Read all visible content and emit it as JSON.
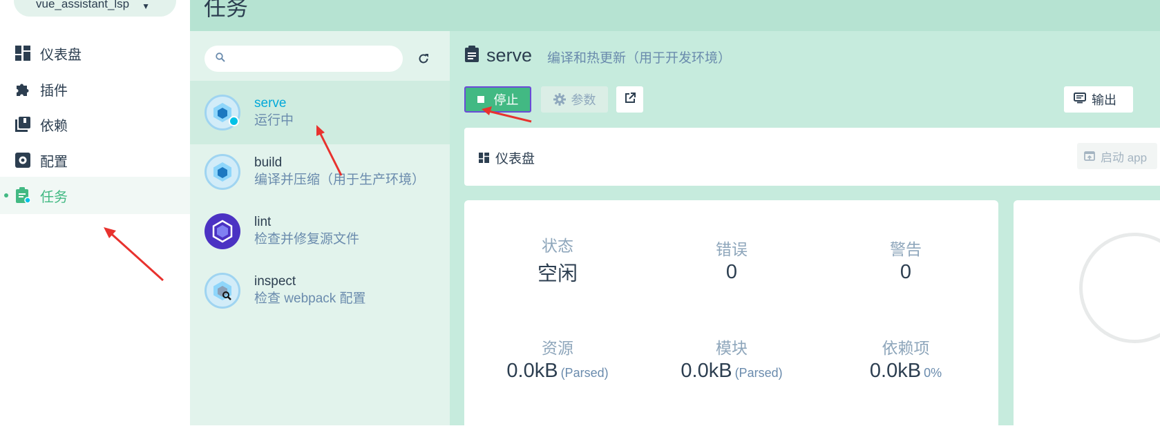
{
  "project": {
    "name": "vue_assistant_lsp"
  },
  "nav": {
    "items": [
      {
        "label": "仪表盘",
        "icon": "dashboard-icon"
      },
      {
        "label": "插件",
        "icon": "puzzle-icon"
      },
      {
        "label": "依赖",
        "icon": "library-icon"
      },
      {
        "label": "配置",
        "icon": "settings-icon"
      },
      {
        "label": "任务",
        "icon": "assignment-icon"
      }
    ],
    "active_index": 4
  },
  "header": {
    "title": "任务"
  },
  "task_list": {
    "search_placeholder": "",
    "tasks": [
      {
        "name": "serve",
        "description": "运行中",
        "status": "running"
      },
      {
        "name": "build",
        "description": "编译并压缩（用于生产环境）"
      },
      {
        "name": "lint",
        "description": "检查并修复源文件"
      },
      {
        "name": "inspect",
        "description": "检查 webpack 配置"
      }
    ]
  },
  "detail": {
    "task_name": "serve",
    "task_description": "编译和热更新（用于开发环境）",
    "buttons": {
      "stop": "停止",
      "params": "参数",
      "output": "输出"
    },
    "dashboard": {
      "label": "仪表盘",
      "start_app": "启动 app"
    },
    "stats": {
      "status": {
        "label": "状态",
        "value": "空闲"
      },
      "errors": {
        "label": "错误",
        "value": "0"
      },
      "warnings": {
        "label": "警告",
        "value": "0"
      },
      "assets": {
        "label": "资源",
        "value": "0.0kB",
        "note": "(Parsed)"
      },
      "modules": {
        "label": "模块",
        "value": "0.0kB",
        "note": "(Parsed)"
      },
      "dependencies": {
        "label": "依赖项",
        "value": "0.0kB",
        "note": "0%"
      }
    }
  },
  "colors": {
    "accent": "#42b983",
    "header_bg": "#b6e3d2",
    "list_bg": "#e2f3ec",
    "detail_bg": "#c6ebdd",
    "running_dot": "#03c2e6",
    "annotation_arrow": "#e8322e"
  }
}
